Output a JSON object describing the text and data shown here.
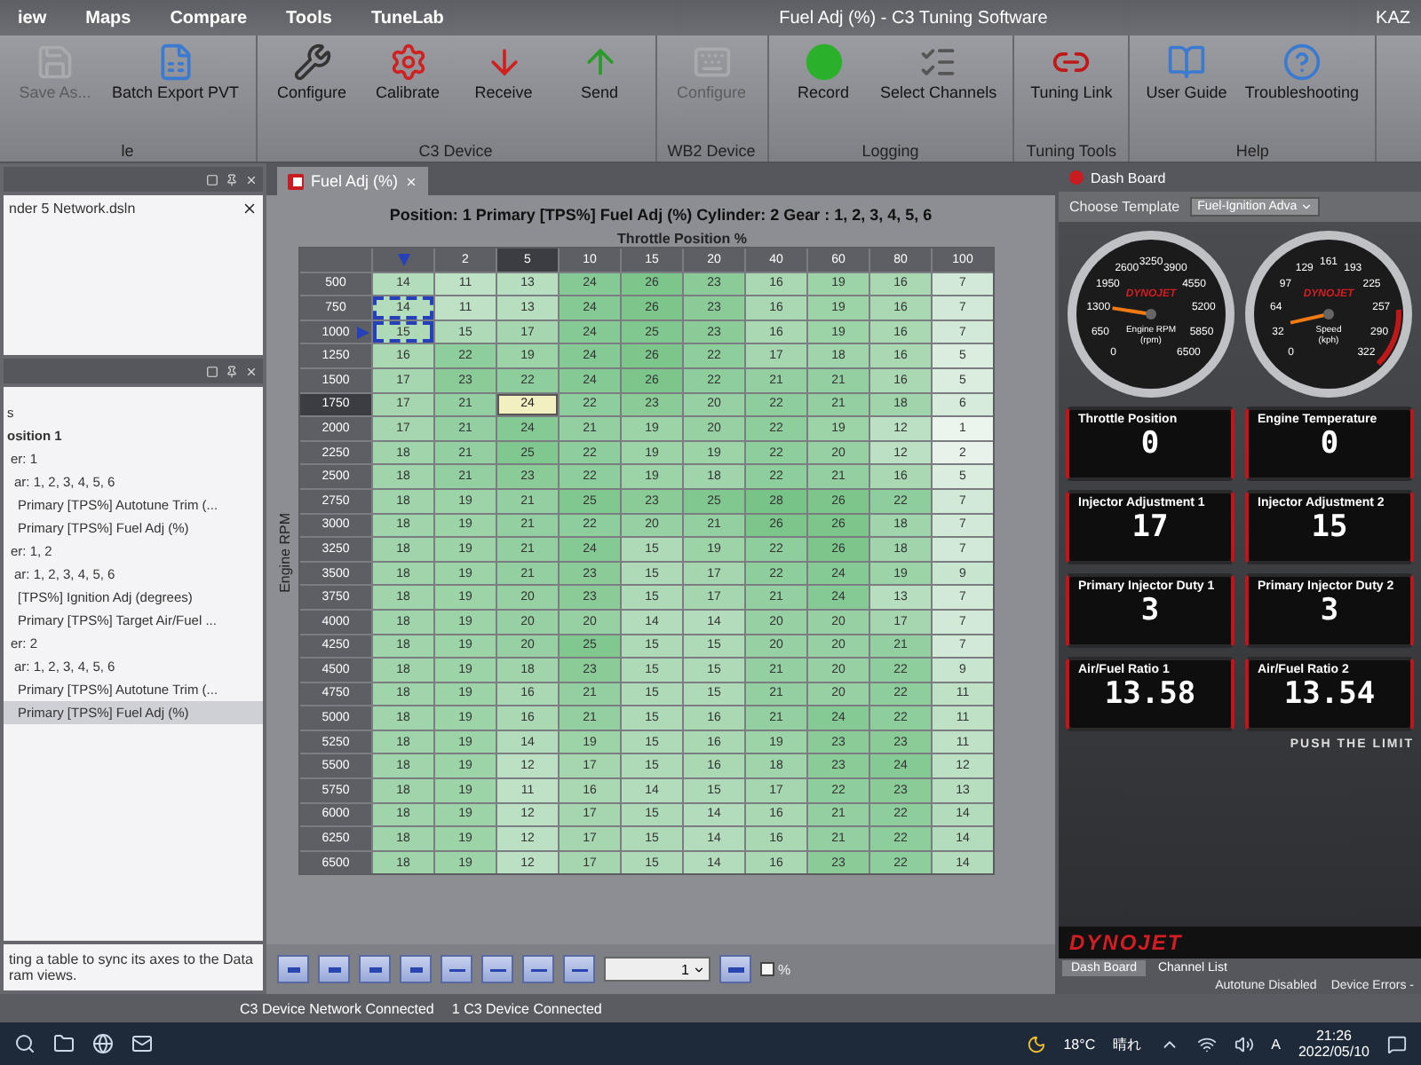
{
  "window": {
    "title": "Fuel Adj (%) - C3 Tuning Software",
    "user": "KAZ"
  },
  "menu": [
    {
      "label": "iew",
      "selected": false
    },
    {
      "label": "Maps",
      "selected": false
    },
    {
      "label": "Compare",
      "selected": false
    },
    {
      "label": "Tools",
      "selected": false
    },
    {
      "label": "TuneLab",
      "selected": false
    }
  ],
  "ribbon": [
    {
      "label": "le",
      "buttons": [
        {
          "label": "Save As...",
          "disabled": true
        },
        {
          "label": "Batch Export PVT",
          "disabled": false
        }
      ]
    },
    {
      "label": "C3 Device",
      "buttons": [
        {
          "label": "Configure",
          "disabled": false
        },
        {
          "label": "Calibrate",
          "disabled": false
        },
        {
          "label": "Receive",
          "disabled": false
        },
        {
          "label": "Send",
          "disabled": false
        }
      ]
    },
    {
      "label": "WB2 Device",
      "buttons": [
        {
          "label": "Configure",
          "disabled": true
        }
      ]
    },
    {
      "label": "Logging",
      "buttons": [
        {
          "label": "Record",
          "disabled": false
        },
        {
          "label": "Select Channels",
          "disabled": false
        }
      ]
    },
    {
      "label": "Tuning Tools",
      "buttons": [
        {
          "label": "Tuning Link",
          "disabled": false
        }
      ]
    },
    {
      "label": "Help",
      "buttons": [
        {
          "label": "User Guide",
          "disabled": false
        },
        {
          "label": "Troubleshooting",
          "disabled": false
        }
      ]
    }
  ],
  "file_panel": {
    "file": "nder 5 Network.dsln"
  },
  "tree": [
    {
      "label": "s",
      "kind": "item",
      "selected": false
    },
    {
      "label": "osition  1",
      "kind": "position",
      "selected": false,
      "children": [
        {
          "label": "er: 1",
          "kind": "item",
          "selected": false,
          "children": [
            {
              "label": "ar: 1, 2, 3, 4, 5, 6",
              "kind": "item",
              "selected": false,
              "children": [
                {
                  "label": "Primary  [TPS%] Autotune Trim (...",
                  "kind": "item",
                  "selected": false
                },
                {
                  "label": "Primary  [TPS%] Fuel Adj (%)",
                  "kind": "item",
                  "selected": false
                }
              ]
            }
          ]
        },
        {
          "label": "er: 1, 2",
          "kind": "item",
          "selected": false,
          "children": [
            {
              "label": "ar: 1, 2, 3, 4, 5, 6",
              "kind": "item",
              "selected": false,
              "children": [
                {
                  "label": "[TPS%] Ignition Adj (degrees)",
                  "kind": "item",
                  "selected": false
                },
                {
                  "label": "Primary  [TPS%] Target Air/Fuel ...",
                  "kind": "item",
                  "selected": false
                }
              ]
            }
          ]
        },
        {
          "label": "er: 2",
          "kind": "item",
          "selected": false,
          "children": [
            {
              "label": "ar: 1, 2, 3, 4, 5, 6",
              "kind": "item",
              "selected": false,
              "children": [
                {
                  "label": "Primary  [TPS%] Autotune Trim (...",
                  "kind": "item",
                  "selected": false
                },
                {
                  "label": "Primary  [TPS%] Fuel Adj (%)",
                  "kind": "item",
                  "selected": true
                }
              ]
            }
          ]
        }
      ]
    }
  ],
  "hint": "ting a table to sync its axes to the Data ram views.",
  "document_tab": {
    "label": "Fuel Adj (%)",
    "selected": true
  },
  "table": {
    "heading": "Position: 1  Primary  [TPS%] Fuel Adj (%)  Cylinder: 2  Gear : 1, 2, 3, 4, 5, 6",
    "x_axis": "Throttle Position %",
    "y_axis": "Engine RPM",
    "columns": [
      {
        "current": true,
        "selected": false
      },
      {
        "label": "2",
        "current": false,
        "selected": false
      },
      {
        "label": "5",
        "current": false,
        "selected": true
      },
      {
        "label": "10",
        "current": false,
        "selected": false
      },
      {
        "label": "15",
        "current": false,
        "selected": false
      },
      {
        "label": "20",
        "current": false,
        "selected": false
      },
      {
        "label": "40",
        "current": false,
        "selected": false
      },
      {
        "label": "60",
        "current": false,
        "selected": false
      },
      {
        "label": "80",
        "current": false,
        "selected": false
      },
      {
        "label": "100",
        "current": false,
        "selected": false
      }
    ],
    "rows": [
      {
        "rpm": "500",
        "current": false,
        "selected": false,
        "bracketed": false,
        "cells": [
          "14",
          "11",
          "13",
          "24",
          "26",
          "23",
          "16",
          "19",
          "16",
          "7"
        ]
      },
      {
        "rpm": "750",
        "current": false,
        "selected": false,
        "bracketed": true,
        "cells": [
          "14",
          "11",
          "13",
          "24",
          "26",
          "23",
          "16",
          "19",
          "16",
          "7"
        ]
      },
      {
        "rpm": "1000",
        "current": true,
        "selected": false,
        "bracketed": true,
        "cells": [
          "15",
          "15",
          "17",
          "24",
          "25",
          "23",
          "16",
          "19",
          "16",
          "7"
        ]
      },
      {
        "rpm": "1250",
        "current": false,
        "selected": false,
        "bracketed": false,
        "cells": [
          "16",
          "22",
          "19",
          "24",
          "26",
          "22",
          "17",
          "18",
          "16",
          "5"
        ]
      },
      {
        "rpm": "1500",
        "current": false,
        "selected": false,
        "bracketed": false,
        "cells": [
          "17",
          "23",
          "22",
          "24",
          "26",
          "22",
          "21",
          "21",
          "16",
          "5"
        ]
      },
      {
        "rpm": "1750",
        "current": false,
        "selected": true,
        "bracketed": false,
        "cells": [
          "17",
          "21",
          "24",
          "22",
          "23",
          "20",
          "22",
          "21",
          "18",
          "6"
        ]
      },
      {
        "rpm": "2000",
        "current": false,
        "selected": false,
        "bracketed": false,
        "cells": [
          "17",
          "21",
          "24",
          "21",
          "19",
          "20",
          "22",
          "19",
          "12",
          "1"
        ]
      },
      {
        "rpm": "2250",
        "current": false,
        "selected": false,
        "bracketed": false,
        "cells": [
          "18",
          "21",
          "25",
          "22",
          "19",
          "19",
          "22",
          "20",
          "12",
          "2"
        ]
      },
      {
        "rpm": "2500",
        "current": false,
        "selected": false,
        "bracketed": false,
        "cells": [
          "18",
          "21",
          "23",
          "22",
          "19",
          "18",
          "22",
          "21",
          "16",
          "5"
        ]
      },
      {
        "rpm": "2750",
        "current": false,
        "selected": false,
        "bracketed": false,
        "cells": [
          "18",
          "19",
          "21",
          "25",
          "23",
          "25",
          "28",
          "26",
          "22",
          "7"
        ]
      },
      {
        "rpm": "3000",
        "current": false,
        "selected": false,
        "bracketed": false,
        "cells": [
          "18",
          "19",
          "21",
          "22",
          "20",
          "21",
          "26",
          "26",
          "18",
          "7"
        ]
      },
      {
        "rpm": "3250",
        "current": false,
        "selected": false,
        "bracketed": false,
        "cells": [
          "18",
          "19",
          "21",
          "24",
          "15",
          "19",
          "22",
          "26",
          "18",
          "7"
        ]
      },
      {
        "rpm": "3500",
        "current": false,
        "selected": false,
        "bracketed": false,
        "cells": [
          "18",
          "19",
          "21",
          "23",
          "15",
          "17",
          "22",
          "24",
          "19",
          "9"
        ]
      },
      {
        "rpm": "3750",
        "current": false,
        "selected": false,
        "bracketed": false,
        "cells": [
          "18",
          "19",
          "20",
          "23",
          "15",
          "17",
          "21",
          "24",
          "13",
          "7"
        ]
      },
      {
        "rpm": "4000",
        "current": false,
        "selected": false,
        "bracketed": false,
        "cells": [
          "18",
          "19",
          "20",
          "20",
          "14",
          "14",
          "20",
          "20",
          "17",
          "7"
        ]
      },
      {
        "rpm": "4250",
        "current": false,
        "selected": false,
        "bracketed": false,
        "cells": [
          "18",
          "19",
          "20",
          "25",
          "15",
          "15",
          "20",
          "20",
          "21",
          "7"
        ]
      },
      {
        "rpm": "4500",
        "current": false,
        "selected": false,
        "bracketed": false,
        "cells": [
          "18",
          "19",
          "18",
          "23",
          "15",
          "15",
          "21",
          "20",
          "22",
          "9"
        ]
      },
      {
        "rpm": "4750",
        "current": false,
        "selected": false,
        "bracketed": false,
        "cells": [
          "18",
          "19",
          "16",
          "21",
          "15",
          "15",
          "21",
          "20",
          "22",
          "11"
        ]
      },
      {
        "rpm": "5000",
        "current": false,
        "selected": false,
        "bracketed": false,
        "cells": [
          "18",
          "19",
          "16",
          "21",
          "15",
          "16",
          "21",
          "24",
          "22",
          "11"
        ]
      },
      {
        "rpm": "5250",
        "current": false,
        "selected": false,
        "bracketed": false,
        "cells": [
          "18",
          "19",
          "14",
          "19",
          "15",
          "16",
          "19",
          "23",
          "23",
          "11"
        ]
      },
      {
        "rpm": "5500",
        "current": false,
        "selected": false,
        "bracketed": false,
        "cells": [
          "18",
          "19",
          "12",
          "17",
          "15",
          "16",
          "18",
          "23",
          "24",
          "12"
        ]
      },
      {
        "rpm": "5750",
        "current": false,
        "selected": false,
        "bracketed": false,
        "cells": [
          "18",
          "19",
          "11",
          "16",
          "14",
          "15",
          "17",
          "22",
          "23",
          "13"
        ]
      },
      {
        "rpm": "6000",
        "current": false,
        "selected": false,
        "bracketed": false,
        "cells": [
          "18",
          "19",
          "12",
          "17",
          "15",
          "14",
          "16",
          "21",
          "22",
          "14"
        ]
      },
      {
        "rpm": "6250",
        "current": false,
        "selected": false,
        "bracketed": false,
        "cells": [
          "18",
          "19",
          "12",
          "17",
          "15",
          "14",
          "16",
          "21",
          "22",
          "14"
        ]
      },
      {
        "rpm": "6500",
        "current": false,
        "selected": false,
        "bracketed": false,
        "cells": [
          "18",
          "19",
          "12",
          "17",
          "15",
          "14",
          "16",
          "23",
          "22",
          "14"
        ]
      }
    ]
  },
  "table_toolbar": {
    "value": "1",
    "percent": {
      "label": "%",
      "checked": false
    }
  },
  "dashboard": {
    "title": "Dash Board",
    "template_label": "Choose Template",
    "template": "Fuel-Ignition Adva",
    "gauges": [
      {
        "logo": "DYNOJET",
        "label": "Engine RPM",
        "unit": "(rpm)",
        "redline": false,
        "ticks": [
          "0",
          "650",
          "1300",
          "1950",
          "2600",
          "3250",
          "3900",
          "4550",
          "5200",
          "5850",
          "6500"
        ]
      },
      {
        "logo": "DYNOJET",
        "label": "Speed",
        "unit": "(kph)",
        "redline": true,
        "ticks": [
          "0",
          "32",
          "64",
          "97",
          "129",
          "161",
          "193",
          "225",
          "257",
          "290",
          "322"
        ]
      }
    ],
    "tiles": [
      {
        "label": "Throttle Position",
        "value": "0"
      },
      {
        "label": "Engine Temperature",
        "value": "0"
      },
      {
        "label": "Injector Adjustment 1",
        "value": "17"
      },
      {
        "label": "Injector Adjustment 2",
        "value": "15"
      },
      {
        "label": "Primary Injector Duty 1",
        "value": "3"
      },
      {
        "label": "Primary Injector Duty 2",
        "value": "3"
      },
      {
        "label": "Air/Fuel Ratio 1",
        "value": "13.58"
      },
      {
        "label": "Air/Fuel Ratio 2",
        "value": "13.54"
      }
    ],
    "slogan": "PUSH THE LIMIT",
    "brand": "DYNOJET",
    "tabs": [
      {
        "label": "Dash Board",
        "selected": true
      },
      {
        "label": "Channel List",
        "selected": false
      }
    ],
    "status": [
      "Autotune Disabled",
      "Device Errors -"
    ]
  },
  "status_bar": [
    "C3 Device Network Connected",
    "1 C3 Device Connected"
  ],
  "taskbar": {
    "temperature": "18°C",
    "weather": "晴れ",
    "ime": "A",
    "time": "21:26",
    "date": "2022/05/10"
  }
}
